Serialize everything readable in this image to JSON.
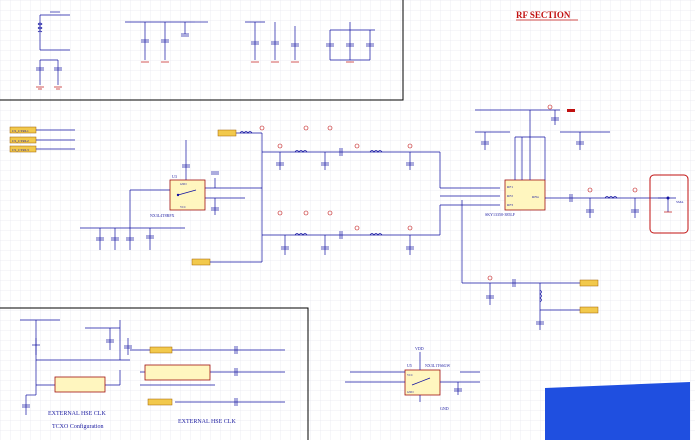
{
  "section_title": "RF SECTION",
  "labels": {
    "hse_main": "EXTERNAL HSE CLK",
    "hse_sub": "TCXO Configuration",
    "hse_alt": "EXTERNAL HSE CLK",
    "ant": "SMA",
    "net_vdd": "VDD",
    "net_gnd": "GND"
  },
  "ports": [
    "CS_CTRL1",
    "CS_CTRL2",
    "CS_CTRL3"
  ],
  "chips": [
    {
      "ref": "U3",
      "part": "NX3L4T8RFX",
      "pins": [
        "GND",
        "VDD",
        "VCC"
      ]
    },
    {
      "ref": "U4",
      "part": "SKY13350-385LF",
      "pins": [
        "RF1",
        "RF2",
        "RF3",
        "RFin"
      ]
    },
    {
      "ref": "U5",
      "part": "NX3L1T66GW",
      "pins": [
        "VCC",
        "GND"
      ]
    }
  ],
  "colors": {
    "wire": "#1010a0",
    "part": "#a01010",
    "grid": "#d8d8e4",
    "annotation": "#d02020",
    "redaction": "#1f4fe0"
  }
}
